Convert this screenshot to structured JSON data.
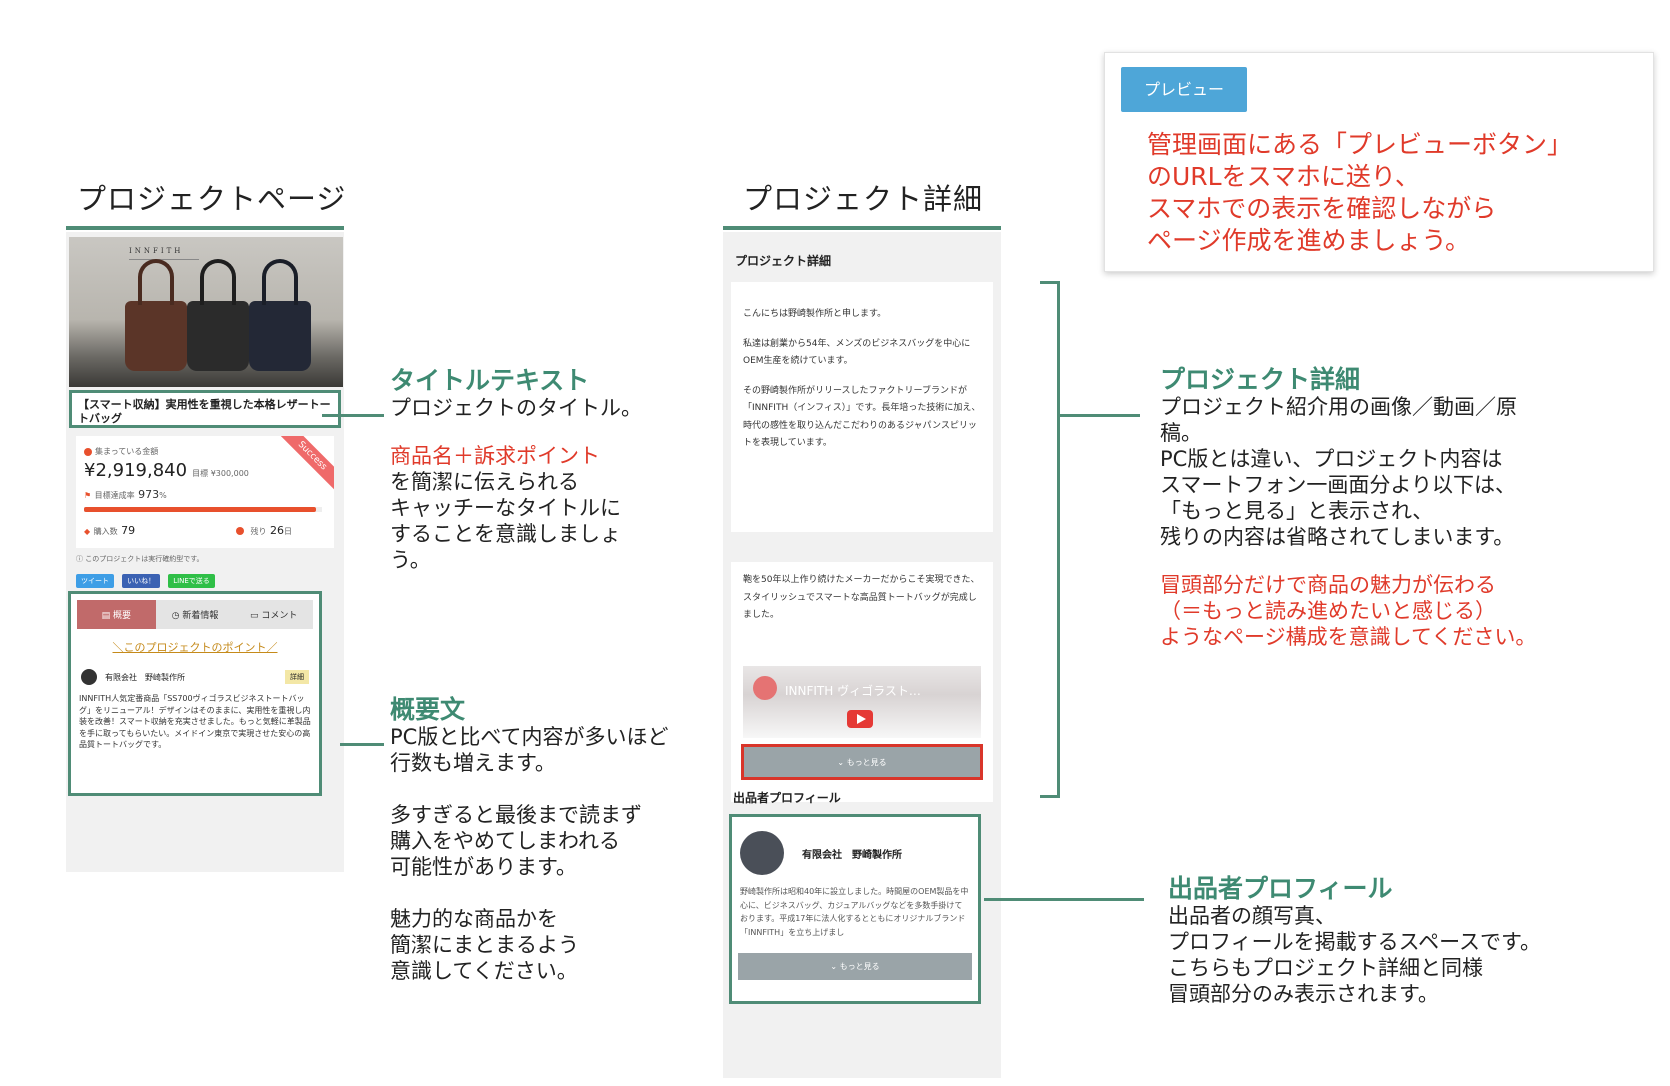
{
  "left_section": {
    "title": "プロジェクトページ",
    "hero_brand": "INNFITH",
    "project_title": "【スマート収納】実用性を重視した本格レザートートバッグ",
    "stats": {
      "collected_label": "集まっている金額",
      "collected_amount": "¥2,919,840",
      "target_label": "目標 ¥300,000",
      "progress_label": "目標達成率",
      "progress_value": "973",
      "progress_unit": "%",
      "progress_fraction": 0.973,
      "buyers_label": "購入数",
      "buyers_value": "79",
      "days_label": "残り",
      "days_value": "26",
      "days_unit": "日",
      "success_ribbon": "Success"
    },
    "notice": "このプロジェクトは実行確約型です。",
    "sns": [
      "ツイート",
      "いいね！",
      "LINEで送る"
    ],
    "tabs": [
      "概要",
      "新着情報",
      "コメント"
    ],
    "points_link": "＼このプロジェクトのポイント／",
    "company": "有限会社　野崎製作所",
    "detail_badge": "詳細",
    "overview_text": "INNFITH人気定番商品「SS700ヴィゴラスビジネストートバッグ」をリニューアル！デザインはそのままに、実用性を重視し内装を改善！スマート収納を充実させました。もっと気軽に革製品を手に取ってもらいたい。メイドイン東京で実現させた安心の高品質トートバッグです。"
  },
  "annotations": {
    "title_text": {
      "heading": "タイトルテキスト",
      "body": "プロジェクトのタイトル。",
      "red": "商品名＋訴求ポイント",
      "body2": "を簡潔に伝えられる\nキャッチーなタイトルに\nすることを意識しましょ\nう。"
    },
    "overview": {
      "heading": "概要文",
      "body": "PC版と比べて内容が多いほど\n行数も増えます。\n\n多すぎると最後まで読まず\n購入をやめてしまわれる\n可能性があります。\n\n魅力的な商品かを\n簡潔にまとまるよう\n意識してください。"
    },
    "detail": {
      "heading": "プロジェクト詳細",
      "body": "プロジェクト紹介用の画像／動画／原\n稿。\nPC版とは違い、プロジェクト内容は\nスマートフォン一画面分より以下は、\n「もっと見る」と表示され、\n残りの内容は省略されてしまいます。",
      "red": "冒頭部分だけで商品の魅力が伝わる\n（＝もっと読み進めたいと感じる）\nようなページ構成を意識してください。"
    },
    "profile": {
      "heading": "出品者プロフィール",
      "body": "出品者の顔写真、\nプロフィールを掲載するスペースです。\nこちらもプロジェクト詳細と同様\n冒頭部分のみ表示されます。"
    }
  },
  "middle_section": {
    "title": "プロジェクト詳細",
    "card_heading": "プロジェクト詳細",
    "para1": "こんにちは野崎製作所と申します。",
    "para2": "私達は創業から54年、メンズのビジネスバッグを中心にOEM生産を続けています。",
    "para3": "その野崎製作所がリリースしたファクトリーブランドが「INNFITH（インフィス）」です。長年培った技術に加え、時代の感性を取り込んだこだわりのあるジャパンスピリットを表現しています。",
    "para4": "鞄を50年以上作り続けたメーカーだからこそ実現できた、スタイリッシュでスマートな高品質トートバッグが完成しました。",
    "video_title": "INNFITH ヴィゴラスト…",
    "more_label": "もっと見る",
    "profile_heading": "出品者プロフィール",
    "profile_name": "有限会社　野崎製作所",
    "profile_text": "野崎製作所は昭和40年に設立しました。時間屋のOEM製品を中心に、ビジネスバッグ、カジュアルバッグなどを多数手掛けております。平成17年に法人化するとともにオリジナルブランド「INNFITH」を立ち上げまし",
    "profile_more": "もっと見る"
  },
  "preview": {
    "button_label": "プレビュー",
    "note": "管理画面にある「プレビューボタン」\nのURLをスマホに送り、\nスマホでの表示を確認しながら\nページ作成を進めましょう。"
  },
  "colors": {
    "accent_green": "#4f8c76",
    "red_text": "#e03a2a",
    "preview_blue": "#4ea6d8",
    "progress_orange": "#e8502d",
    "more_button": "#9aa4a8"
  }
}
